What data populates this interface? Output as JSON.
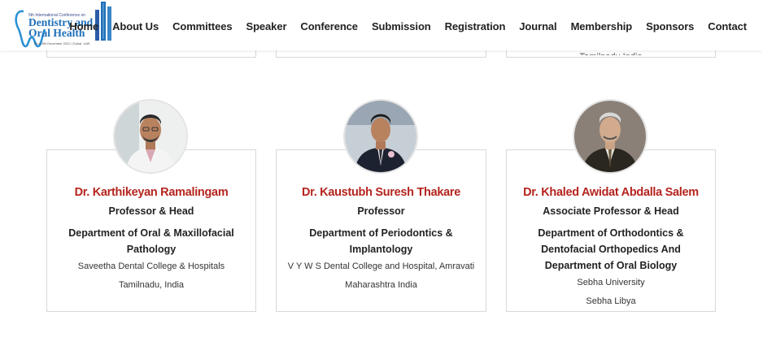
{
  "logo": {
    "line_top": "5th International Conference on",
    "line1": "Dentistry and",
    "line2": "Oral Health",
    "line_bottom": "7th & 8th December 2022 | Dubai, UAE"
  },
  "nav": [
    "Home",
    "About Us",
    "Committees",
    "Speaker",
    "Conference",
    "Submission",
    "Registration",
    "Journal",
    "Membership",
    "Sponsors",
    "Contact"
  ],
  "top_partial_text": "Tamilnadu India",
  "speakers": [
    {
      "name": "Dr. Karthikeyan Ramalingam",
      "title": "Professor & Head",
      "department": "Department of Oral & Maxillofacial Pathology",
      "organization": "Saveetha Dental College & Hospitals",
      "location": "Tamilnadu, India"
    },
    {
      "name": "Dr. Kaustubh Suresh Thakare",
      "title": "Professor",
      "department": "Department of Periodontics & Implantology",
      "organization": "V Y W S Dental College and Hospital, Amravati",
      "location": "Maharashtra India"
    },
    {
      "name": "Dr. Khaled Awidat Abdalla Salem",
      "title": "Associate Professor & Head",
      "department": "Department of Orthodontics & Dentofacial Orthopedics And Department of Oral Biology",
      "organization": "Sebha University",
      "location": "Sebha Libya"
    }
  ],
  "colors": {
    "name": "#b5241e",
    "logo": "#1e6fb8",
    "border": "#d9d9d9"
  }
}
